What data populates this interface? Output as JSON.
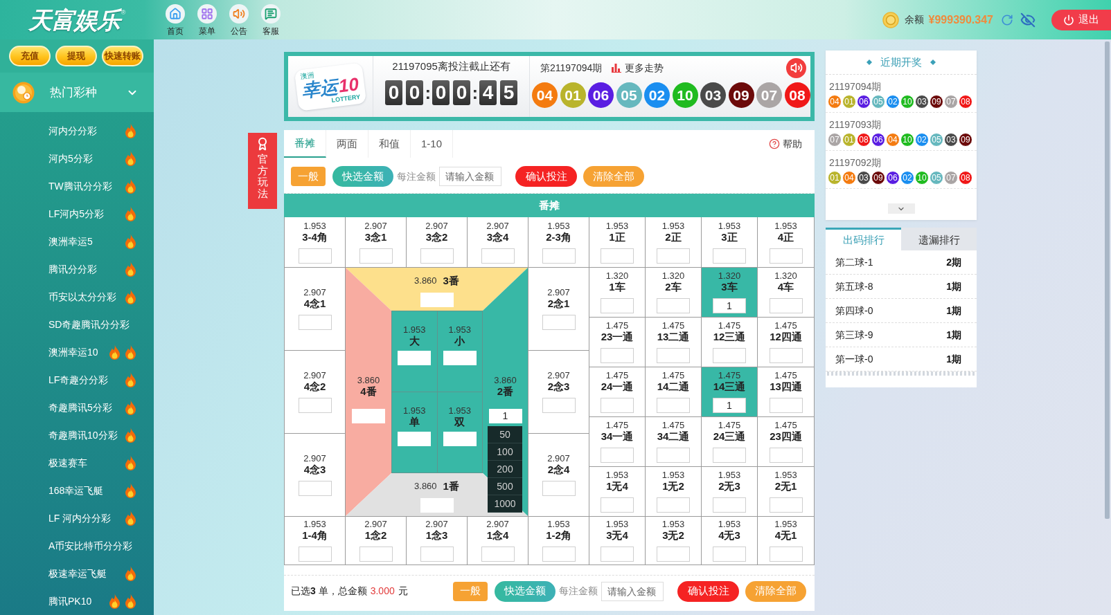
{
  "header": {
    "logo": "天富娱乐",
    "logo_mark": "®",
    "nav": [
      {
        "kind": "home",
        "label": "首页"
      },
      {
        "kind": "menu",
        "label": "菜单"
      },
      {
        "kind": "notice",
        "label": "公告"
      },
      {
        "kind": "service",
        "label": "客服"
      }
    ],
    "balance_label": "余额",
    "balance": "¥999390.347",
    "logout": "退出"
  },
  "sidebar": {
    "actions": [
      "充值",
      "提现",
      "快速转账"
    ],
    "category": {
      "title": "热门彩种",
      "expanded": true
    },
    "items": [
      {
        "label": "河内分分彩",
        "kind": "hot"
      },
      {
        "label": "河内5分彩",
        "kind": "hot"
      },
      {
        "label": "TW腾讯分分彩",
        "kind": "hot"
      },
      {
        "label": "LF河内5分彩",
        "kind": "hot"
      },
      {
        "label": "澳洲幸运5",
        "kind": "hot"
      },
      {
        "label": "腾讯分分彩",
        "kind": "hot"
      },
      {
        "label": "币安以太分分彩",
        "kind": "hot"
      },
      {
        "label": "SD奇趣腾讯分分彩",
        "kind": "plain"
      },
      {
        "label": "澳洲幸运10",
        "kind": "very-hot"
      },
      {
        "label": "LF奇趣分分彩",
        "kind": "hot"
      },
      {
        "label": "奇趣腾讯5分彩",
        "kind": "hot"
      },
      {
        "label": "奇趣腾讯10分彩",
        "kind": "hot"
      },
      {
        "label": "极速赛车",
        "kind": "hot"
      },
      {
        "label": "168幸运飞艇",
        "kind": "hot"
      },
      {
        "label": "LF 河内分分彩",
        "kind": "hot"
      },
      {
        "label": "A币安比特币分分彩",
        "kind": "plain"
      },
      {
        "label": "极速幸运飞艇",
        "kind": "hot"
      },
      {
        "label": "腾讯PK10",
        "kind": "very-hot"
      }
    ]
  },
  "official_tab": "官方玩法",
  "lottery": {
    "logo": {
      "region": "澳洲",
      "name": "幸运",
      "number": "10",
      "tag": "LOTTERY"
    },
    "countdown": {
      "title": "21197095离投注截止还有",
      "cells": [
        {
          "kind": "digit",
          "text": "0"
        },
        {
          "kind": "digit",
          "text": "0"
        },
        {
          "kind": "separator",
          "text": ":"
        },
        {
          "kind": "digit",
          "text": "0"
        },
        {
          "kind": "digit",
          "text": "0"
        },
        {
          "kind": "separator",
          "text": ":"
        },
        {
          "kind": "digit",
          "text": "4"
        },
        {
          "kind": "digit",
          "text": "5"
        }
      ]
    },
    "result": {
      "period": "第21197094期",
      "trend_link": "更多走势",
      "sound_on": true,
      "balls": [
        {
          "number": "04",
          "color": "#f47b10"
        },
        {
          "number": "01",
          "color": "#b9b42c"
        },
        {
          "number": "06",
          "color": "#5a1ee2"
        },
        {
          "number": "05",
          "color": "#66b8be"
        },
        {
          "number": "02",
          "color": "#1a8ef0"
        },
        {
          "number": "10",
          "color": "#20bb20"
        },
        {
          "number": "03",
          "color": "#4a4a4a"
        },
        {
          "number": "09",
          "color": "#6c0a0a"
        },
        {
          "number": "07",
          "color": "#aaa5a5"
        },
        {
          "number": "08",
          "color": "#f01818"
        }
      ]
    }
  },
  "play_tabs": [
    {
      "label": "番摊",
      "selected": true
    },
    {
      "label": "两面",
      "selected": false
    },
    {
      "label": "和值",
      "selected": false
    },
    {
      "label": "1-10",
      "selected": false
    }
  ],
  "help": "帮助",
  "toolbar": {
    "mode_button": "一般",
    "quick_button": "快选金额",
    "amount_label": "每注金额",
    "amount_placeholder": "请输入金额",
    "confirm_button": "确认投注",
    "clear_button": "清除全部"
  },
  "board": {
    "title": "番摊",
    "top_row": [
      {
        "odds": "1.953",
        "label": "3-4角",
        "selected": false
      },
      {
        "odds": "2.907",
        "label": "3念1",
        "selected": false
      },
      {
        "odds": "2.907",
        "label": "3念2",
        "selected": false
      },
      {
        "odds": "2.907",
        "label": "3念4",
        "selected": false
      },
      {
        "odds": "1.953",
        "label": "2-3角",
        "selected": false
      },
      {
        "odds": "1.953",
        "label": "1正",
        "selected": false
      },
      {
        "odds": "1.953",
        "label": "2正",
        "selected": false
      },
      {
        "odds": "1.953",
        "label": "3正",
        "selected": false
      },
      {
        "odds": "1.953",
        "label": "4正",
        "selected": false
      }
    ],
    "left_column": [
      {
        "odds": "2.907",
        "label": "4念1",
        "selected": false
      },
      {
        "odds": "2.907",
        "label": "4念2",
        "selected": false
      },
      {
        "odds": "2.907",
        "label": "4念3",
        "selected": false
      }
    ],
    "fan": {
      "regions": [
        {
          "kind": "top",
          "odds": "3.860",
          "label": "3番",
          "color": "#fde08c"
        },
        {
          "kind": "left",
          "odds": "3.860",
          "label": "4番",
          "color": "#f8aca1"
        },
        {
          "kind": "right",
          "odds": "3.860",
          "label": "2番",
          "color": "#38b8a6",
          "value": "1",
          "quick_amounts": [
            "50",
            "100",
            "200",
            "500",
            "1000"
          ]
        },
        {
          "kind": "bottom",
          "odds": "3.860",
          "label": "1番",
          "color": "#e1e1e1"
        }
      ],
      "center": [
        {
          "odds": "1.953",
          "label": "大",
          "selected": false
        },
        {
          "odds": "1.953",
          "label": "小",
          "selected": false
        },
        {
          "odds": "1.953",
          "label": "单",
          "selected": false
        },
        {
          "odds": "1.953",
          "label": "双",
          "selected": false
        }
      ]
    },
    "right_column": [
      {
        "odds": "2.907",
        "label": "2念1",
        "selected": false
      },
      {
        "odds": "2.907",
        "label": "2念3",
        "selected": false
      },
      {
        "odds": "2.907",
        "label": "2念4",
        "selected": false
      }
    ],
    "right_block": [
      [
        {
          "odds": "1.320",
          "label": "1车",
          "selected": false
        },
        {
          "odds": "1.320",
          "label": "2车",
          "selected": false
        },
        {
          "odds": "1.320",
          "label": "3车",
          "selected": true,
          "value": "1"
        },
        {
          "odds": "1.320",
          "label": "4车",
          "selected": false
        }
      ],
      [
        {
          "odds": "1.475",
          "label": "23一通",
          "selected": false
        },
        {
          "odds": "1.475",
          "label": "13二通",
          "selected": false
        },
        {
          "odds": "1.475",
          "label": "12三通",
          "selected": false
        },
        {
          "odds": "1.475",
          "label": "12四通",
          "selected": false
        }
      ],
      [
        {
          "odds": "1.475",
          "label": "24一通",
          "selected": false
        },
        {
          "odds": "1.475",
          "label": "14二通",
          "selected": false
        },
        {
          "odds": "1.475",
          "label": "14三通",
          "selected": true,
          "value": "1"
        },
        {
          "odds": "1.475",
          "label": "13四通",
          "selected": false
        }
      ],
      [
        {
          "odds": "1.475",
          "label": "34一通",
          "selected": false
        },
        {
          "odds": "1.475",
          "label": "34二通",
          "selected": false
        },
        {
          "odds": "1.475",
          "label": "24三通",
          "selected": false
        },
        {
          "odds": "1.475",
          "label": "23四通",
          "selected": false
        }
      ],
      [
        {
          "odds": "1.953",
          "label": "1无4",
          "selected": false
        },
        {
          "odds": "1.953",
          "label": "1无2",
          "selected": false
        },
        {
          "odds": "1.953",
          "label": "2无3",
          "selected": false
        },
        {
          "odds": "1.953",
          "label": "2无1",
          "selected": false
        }
      ]
    ],
    "bottom_row": [
      {
        "odds": "1.953",
        "label": "1-4角",
        "selected": false
      },
      {
        "odds": "2.907",
        "label": "1念2",
        "selected": false
      },
      {
        "odds": "2.907",
        "label": "1念3",
        "selected": false
      },
      {
        "odds": "2.907",
        "label": "1念4",
        "selected": false
      },
      {
        "odds": "1.953",
        "label": "1-2角",
        "selected": false
      },
      {
        "odds": "1.953",
        "label": "3无4",
        "selected": false
      },
      {
        "odds": "1.953",
        "label": "3无2",
        "selected": false
      },
      {
        "odds": "1.953",
        "label": "4无3",
        "selected": false
      },
      {
        "odds": "1.953",
        "label": "4无1",
        "selected": false
      }
    ]
  },
  "footer": {
    "summary": "已选**3** 单，总金额",
    "total": "3.000",
    "unit": "元",
    "toolbar": {
      "mode_button": "一般",
      "quick_button": "快选金额",
      "amount_label": "每注金额",
      "amount_placeholder": "请输入金额",
      "confirm_button": "确认投注",
      "clear_button": "清除全部"
    }
  },
  "recent": {
    "title": "近期开奖",
    "draws": [
      {
        "period": "21197094期",
        "balls": [
          {
            "number": "04",
            "color": "#f47b10"
          },
          {
            "number": "01",
            "color": "#b9b42c"
          },
          {
            "number": "06",
            "color": "#5a1ee2"
          },
          {
            "number": "05",
            "color": "#66b8be"
          },
          {
            "number": "02",
            "color": "#1a8ef0"
          },
          {
            "number": "10",
            "color": "#20bb20"
          },
          {
            "number": "03",
            "color": "#4a4a4a"
          },
          {
            "number": "09",
            "color": "#6c0a0a"
          },
          {
            "number": "07",
            "color": "#aaa5a5"
          },
          {
            "number": "08",
            "color": "#f01818"
          }
        ]
      },
      {
        "period": "21197093期",
        "balls": [
          {
            "number": "07",
            "color": "#aaa5a5"
          },
          {
            "number": "01",
            "color": "#b9b42c"
          },
          {
            "number": "08",
            "color": "#f01818"
          },
          {
            "number": "06",
            "color": "#5a1ee2"
          },
          {
            "number": "04",
            "color": "#f47b10"
          },
          {
            "number": "10",
            "color": "#20bb20"
          },
          {
            "number": "02",
            "color": "#1a8ef0"
          },
          {
            "number": "05",
            "color": "#66b8be"
          },
          {
            "number": "03",
            "color": "#4a4a4a"
          },
          {
            "number": "09",
            "color": "#6c0a0a"
          }
        ]
      },
      {
        "period": "21197092期",
        "balls": [
          {
            "number": "01",
            "color": "#b9b42c"
          },
          {
            "number": "04",
            "color": "#f47b10"
          },
          {
            "number": "03",
            "color": "#4a4a4a"
          },
          {
            "number": "09",
            "color": "#6c0a0a"
          },
          {
            "number": "06",
            "color": "#5a1ee2"
          },
          {
            "number": "02",
            "color": "#1a8ef0"
          },
          {
            "number": "10",
            "color": "#20bb20"
          },
          {
            "number": "05",
            "color": "#66b8be"
          },
          {
            "number": "07",
            "color": "#aaa5a5"
          },
          {
            "number": "08",
            "color": "#f01818"
          }
        ]
      }
    ]
  },
  "ranking": {
    "tabs": [
      {
        "label": "出码排行",
        "selected": true
      },
      {
        "label": "遗漏排行",
        "selected": false
      }
    ],
    "rows": [
      {
        "name": "第二球-1",
        "count": "2期"
      },
      {
        "name": "第五球-8",
        "count": "1期"
      },
      {
        "name": "第四球-0",
        "count": "1期"
      },
      {
        "name": "第三球-9",
        "count": "1期"
      },
      {
        "name": "第一球-0",
        "count": "1期"
      }
    ]
  }
}
